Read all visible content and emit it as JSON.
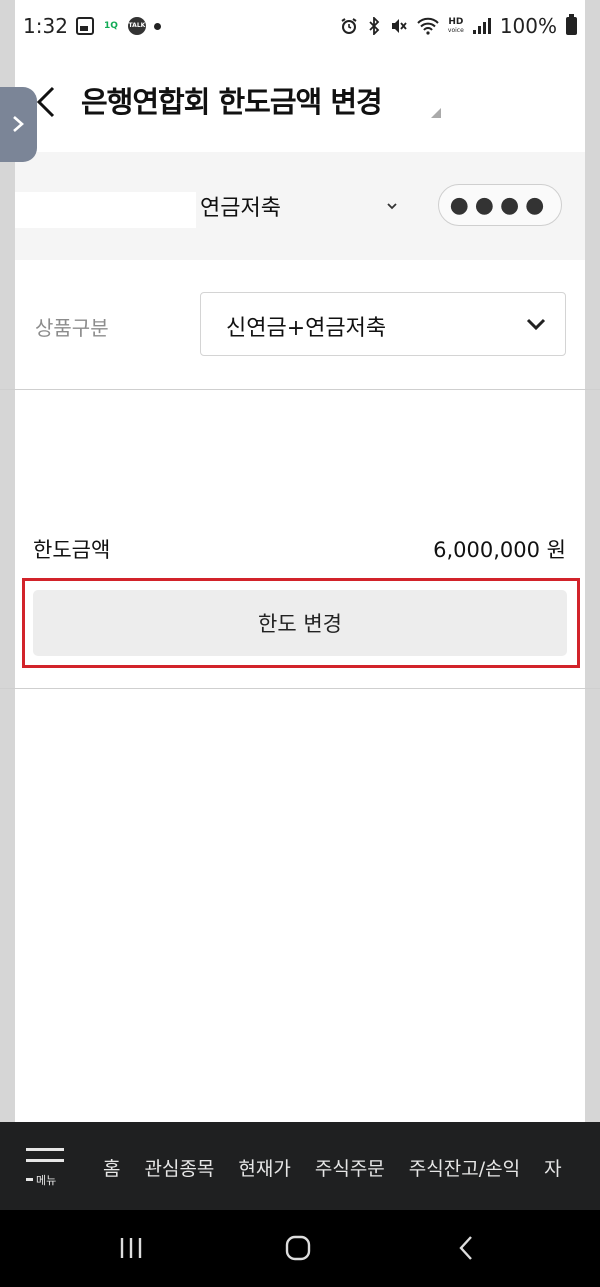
{
  "status_bar": {
    "time": "1:32",
    "app_badge": "1Q",
    "talk_badge": "TALK",
    "hd_label": "HD",
    "voice_label": "voice",
    "battery": "100%"
  },
  "header": {
    "title": "은행연합회 한도금액 변경"
  },
  "account": {
    "type": "연금저축",
    "password_mask": "●●●●"
  },
  "product": {
    "label": "상품구분",
    "selected": "신연금+연금저축"
  },
  "limit": {
    "label": "한도금액",
    "value": "6,000,000 원",
    "button_label": "한도 변경"
  },
  "bottom_menu": {
    "menu_label": "메뉴",
    "items": [
      "홈",
      "관심종목",
      "현재가",
      "주식주문",
      "주식잔고/손익",
      "자"
    ]
  },
  "colors": {
    "highlight": "#d2232a",
    "side_tab": "#7b8597",
    "menu_bg": "#1f2021"
  }
}
